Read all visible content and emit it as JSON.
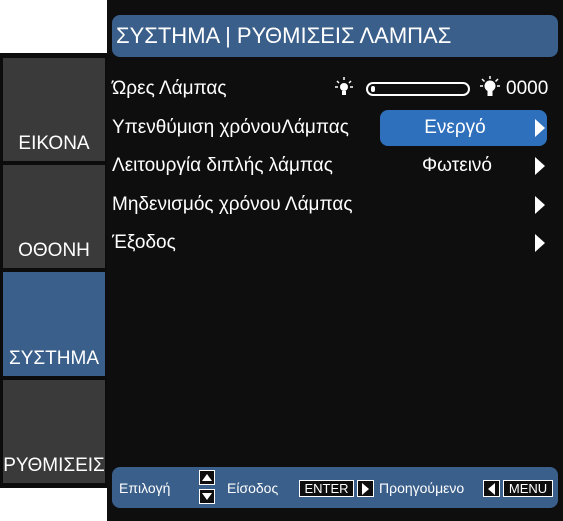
{
  "sidebar": {
    "tabs": [
      {
        "label": "ΕΙΚΟΝΑ",
        "active": false
      },
      {
        "label": "ΟΘΟΝΗ",
        "active": false
      },
      {
        "label": "ΣΥΣΤΗΜΑ",
        "active": true
      },
      {
        "label": "ΡΥΘΜΙΣΕΙΣ",
        "active": false
      }
    ]
  },
  "header": {
    "title": "ΣΥΣΤΗΜΑ | ΡΥΘΜΙΣΕΙΣ ΛΑΜΠΑΣ"
  },
  "menu": {
    "lamp_hours": {
      "label": "Ώρες Λάμπας",
      "value": "0000",
      "icons": [
        "lamp-small-icon",
        "lamp-large-icon"
      ]
    },
    "lamp_reminder": {
      "label": "Υπενθύμιση  χρόνουΛάμπας",
      "value": "Ενεργό"
    },
    "dual_lamp_mode": {
      "label": "Λειτουργία διπλής λάμπας",
      "value": "Φωτεινό"
    },
    "lamp_reset": {
      "label": "Μηδενισμός χρόνου Λάμπας"
    },
    "exit": {
      "label": "Έξοδος"
    }
  },
  "footer": {
    "select_label": "Επιλογή",
    "enter_label": "Είσοδος",
    "enter_key": "ENTER",
    "back_label": "Προηγούμενο",
    "menu_key": "MENU"
  },
  "colors": {
    "accent": "#3a5f8a",
    "highlight": "#2f70bd",
    "panel_bg": "#0e0e0e",
    "tab_bg": "#3a3a3a"
  }
}
